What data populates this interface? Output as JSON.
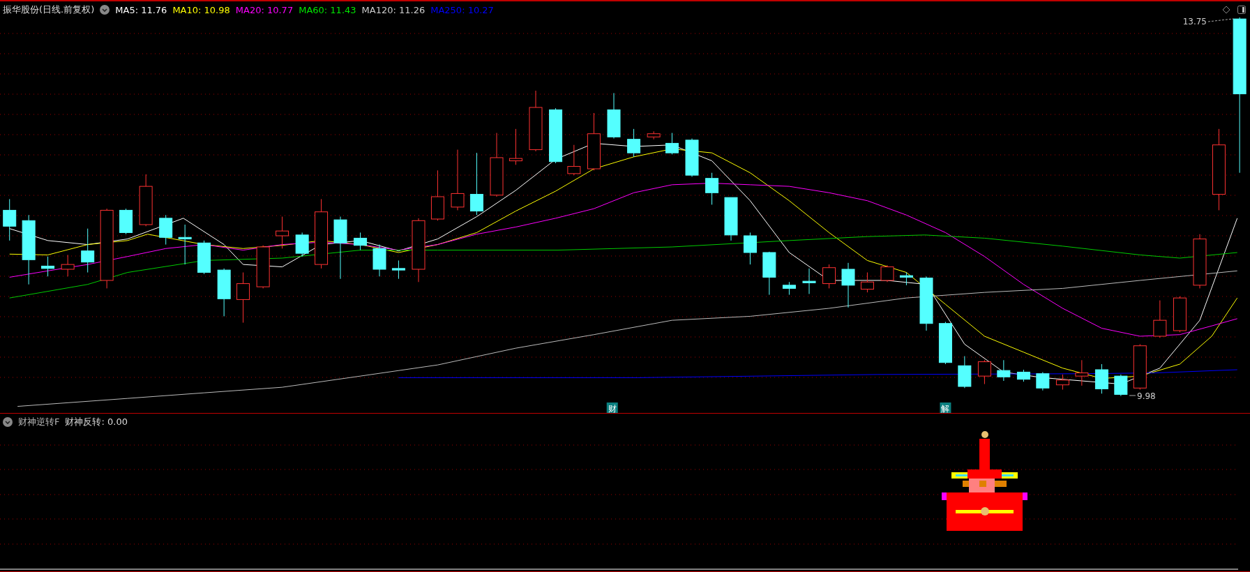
{
  "header": {
    "title": "振华股份(日线.前复权)",
    "averages": [
      {
        "label": "MA5: 11.76",
        "color": "#ffffff"
      },
      {
        "label": "MA10: 10.98",
        "color": "#ffff00"
      },
      {
        "label": "MA20: 10.77",
        "color": "#ff00ff"
      },
      {
        "label": "MA60: 11.43",
        "color": "#00e600"
      },
      {
        "label": "MA120: 11.26",
        "color": "#cccccc"
      },
      {
        "label": "MA250: 10.27",
        "color": "#0000ff"
      }
    ]
  },
  "price_labels": {
    "high": "13.75",
    "low": "9.98"
  },
  "markers": [
    {
      "text": "财"
    },
    {
      "text": "解"
    }
  ],
  "indicator": {
    "name": "财神逆转F",
    "reading": "财神反转: 0.00"
  }
}
